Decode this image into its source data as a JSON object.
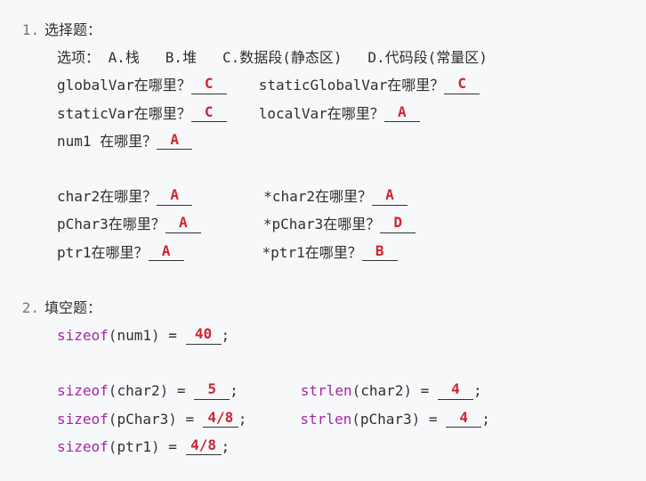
{
  "q1": {
    "number": "1.",
    "title": "选择题：",
    "options_line": "选项： A.栈   B.堆   C.数据段(静态区)   D.代码段(常量区)",
    "rows": [
      {
        "left_label": "globalVar在哪里？",
        "left_ans": "C",
        "right_label": "staticGlobalVar在哪里？",
        "right_ans": "C"
      },
      {
        "left_label": "staticVar在哪里？",
        "left_ans": "C",
        "right_label": "localVar在哪里？",
        "right_ans": "A"
      },
      {
        "left_label": "num1 在哪里？",
        "left_ans": "A",
        "right_label": "",
        "right_ans": ""
      }
    ],
    "rows2": [
      {
        "left_label": "char2在哪里？",
        "left_ans": "A",
        "right_label": "*char2在哪里？",
        "right_ans": "A"
      },
      {
        "left_label": "pChar3在哪里？",
        "left_ans": "A",
        "right_label": "*pChar3在哪里？",
        "right_ans": "D"
      },
      {
        "left_label": "ptr1在哪里？",
        "left_ans": "A",
        "right_label": "*ptr1在哪里？",
        "right_ans": "B"
      }
    ]
  },
  "q2": {
    "number": "2.",
    "title": "填空题：",
    "lines": [
      {
        "left_fn": "sizeof",
        "left_arg": "num1",
        "left_ans": "40",
        "right_fn": "",
        "right_arg": "",
        "right_ans": ""
      },
      {
        "blank": true
      },
      {
        "left_fn": "sizeof",
        "left_arg": "char2",
        "left_ans": "5",
        "right_fn": "strlen",
        "right_arg": "char2",
        "right_ans": "4"
      },
      {
        "left_fn": "sizeof",
        "left_arg": "pChar3",
        "left_ans": "4/8",
        "right_fn": "strlen",
        "right_arg": "pChar3",
        "right_ans": "4"
      },
      {
        "left_fn": "sizeof",
        "left_arg": "ptr1",
        "left_ans": "4/8",
        "right_fn": "",
        "right_arg": "",
        "right_ans": ""
      }
    ]
  }
}
